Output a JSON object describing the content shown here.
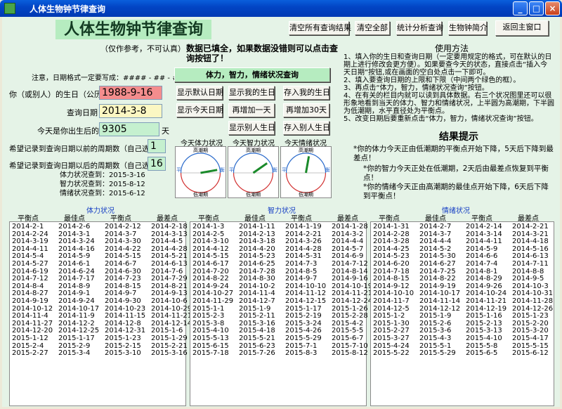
{
  "window": {
    "title": "人体生物钟节律查询"
  },
  "header": {
    "main_title": "人体生物钟节律查询",
    "subtitle": "（仅作参考，不可认真）",
    "notice": "数据已填全，如果数据没错则可以点击查询按钮了！"
  },
  "toolbar": {
    "clear_results": "清空所有查询结果",
    "clear_all": "清空全部",
    "stats": "统计分析查询",
    "intro": "生物钟简介",
    "back": "返回主窗口"
  },
  "form": {
    "date_format_note": "注意，日期格式一定要写成：#### - ## - ##",
    "query_button": "体力，智力，情绪状况查询",
    "birthday_label": "你（或别人）的生日（公历）",
    "birthday_value": "1988-9-16",
    "query_date_label": "查询日期",
    "query_date_value": "2014-3-8",
    "days_label": "今天是你出生后的第",
    "days_value": "9305",
    "days_unit": "天",
    "before_label": "希望记录到查询日期以前的周期数（自己选）",
    "before_value": "1",
    "after_label": "希望记录到查询日期以后的周期数（自己选）",
    "after_value": "16",
    "phys_end": "体力状况查到：2015-3-16",
    "intel_end": "智力状况查到：2015-8-12",
    "emot_end": "情绪状况查到：2015-6-12"
  },
  "buttons": {
    "show_default_birthday": "显示默认日期",
    "show_my_birthday": "显示我的生日",
    "save_my_birthday": "存入我的生日",
    "show_today": "显示今天日期",
    "add_one_day": "再增加一天",
    "add_30_days": "再增加30天",
    "show_other_birthday": "显示别人生日",
    "save_other_birthday": "存入别人生日"
  },
  "charts": [
    {
      "title": "今天体力状况",
      "top_label": "高潮期",
      "bottom_label": "低潮期",
      "left_label": "平",
      "right_label": "衡",
      "needle_angle_deg": -10
    },
    {
      "title": "今天智力状况",
      "top_label": "高潮期",
      "bottom_label": "低潮期",
      "left_label": "平",
      "right_label": "衡",
      "needle_angle_deg": -35
    },
    {
      "title": "今天情绪状况",
      "top_label": "高潮期",
      "bottom_label": "低潮期",
      "left_label": "平",
      "right_label": "衡",
      "needle_angle_deg": -80
    }
  ],
  "usage": {
    "title": "使用方法",
    "steps": [
      "1、填入你的生日和查询日期（一定要用规定的格式，可在默认的日期上进行修改会更方便）。如果要查今天的状态，直接点击“插入今天日期”按钮,或在画面的空白处点击一下即可。",
      "2、填入要查询日期的上限和下限（中间两个绿色的框）。",
      "3、再点击“体力，智力，情绪状况查询”按钮。",
      "4、在有关的栏目内就可以读到具体数据。右三个状况图里还可以很形象地看到当天的体力、智力和情绪状况，上半圆为高潮期，下半圆为低潮期，水平直径处为平衡点。",
      "5、改变日期后要重新点击“体力，智力，情绪状况查询”按钮。"
    ]
  },
  "result": {
    "title": "结果提示",
    "lines": [
      "*你的体力今天正由低潮期的平衡点开始下降，5天后下降到最差点！",
      "*你的智力今天正处在低潮期，2天后由最差点恢复到平衡点！",
      "*你的情绪今天正由高潮期的最佳点开始下降，6天后下降到平衡点！"
    ]
  },
  "lists": [
    {
      "title": "体力状况",
      "headers": [
        "平衡点",
        "最佳点",
        "平衡点",
        "最差点"
      ],
      "rows": [
        [
          "2014-2-1",
          "2014-2-6",
          "2014-2-12",
          "2014-2-18"
        ],
        [
          "2014-2-24",
          "2014-3-1",
          "2014-3-7",
          "2014-3-13"
        ],
        [
          "2014-3-19",
          "2014-3-24",
          "2014-3-30",
          "2014-4-5"
        ],
        [
          "2014-4-11",
          "2014-4-16",
          "2014-4-22",
          "2014-4-28"
        ],
        [
          "2014-5-4",
          "2014-5-9",
          "2014-5-15",
          "2014-5-21"
        ],
        [
          "2014-5-27",
          "2014-6-1",
          "2014-6-7",
          "2014-6-13"
        ],
        [
          "2014-6-19",
          "2014-6-24",
          "2014-6-30",
          "2014-7-6"
        ],
        [
          "2014-7-12",
          "2014-7-17",
          "2014-7-23",
          "2014-7-29"
        ],
        [
          "2014-8-4",
          "2014-8-9",
          "2014-8-15",
          "2014-8-21"
        ],
        [
          "2014-8-27",
          "2014-9-1",
          "2014-9-7",
          "2014-9-13"
        ],
        [
          "2014-9-19",
          "2014-9-24",
          "2014-9-30",
          "2014-10-6"
        ],
        [
          "2014-10-12",
          "2014-10-17",
          "2014-10-23",
          "2014-10-29"
        ],
        [
          "2014-11-4",
          "2014-11-9",
          "2014-11-15",
          "2014-11-21"
        ],
        [
          "2014-11-27",
          "2014-12-2",
          "2014-12-8",
          "2014-12-14"
        ],
        [
          "2014-12-20",
          "2014-12-25",
          "2014-12-31",
          "2015-1-6"
        ],
        [
          "2015-1-12",
          "2015-1-17",
          "2015-1-23",
          "2015-1-29"
        ],
        [
          "2015-2-4",
          "2015-2-9",
          "2015-2-15",
          "2015-2-21"
        ],
        [
          "2015-2-27",
          "2015-3-4",
          "2015-3-10",
          "2015-3-16"
        ]
      ]
    },
    {
      "title": "智力状况",
      "headers": [
        "平衡点",
        "最佳点",
        "平衡点",
        "最差点"
      ],
      "rows": [
        [
          "2014-1-3",
          "2014-1-11",
          "2014-1-19",
          "2014-1-28"
        ],
        [
          "2014-2-5",
          "2014-2-13",
          "2014-2-21",
          "2014-3-2"
        ],
        [
          "2014-3-10",
          "2014-3-18",
          "2014-3-26",
          "2014-4-4"
        ],
        [
          "2014-4-12",
          "2014-4-20",
          "2014-4-28",
          "2014-5-7"
        ],
        [
          "2014-5-15",
          "2014-5-23",
          "2014-5-31",
          "2014-6-9"
        ],
        [
          "2014-6-17",
          "2014-6-25",
          "2014-7-3",
          "2014-7-12"
        ],
        [
          "2014-7-20",
          "2014-7-28",
          "2014-8-5",
          "2014-8-14"
        ],
        [
          "2014-8-22",
          "2014-8-30",
          "2014-9-7",
          "2014-9-16"
        ],
        [
          "2014-9-24",
          "2014-10-2",
          "2014-10-10",
          "2014-10-19"
        ],
        [
          "2014-10-27",
          "2014-11-4",
          "2014-11-12",
          "2014-11-21"
        ],
        [
          "2014-11-29",
          "2014-12-7",
          "2014-12-15",
          "2014-12-24"
        ],
        [
          "2015-1-1",
          "2015-1-9",
          "2015-1-17",
          "2015-1-26"
        ],
        [
          "2015-2-3",
          "2015-2-11",
          "2015-2-19",
          "2015-2-28"
        ],
        [
          "2015-3-8",
          "2015-3-16",
          "2015-3-24",
          "2015-4-2"
        ],
        [
          "2015-4-10",
          "2015-4-18",
          "2015-4-26",
          "2015-5-5"
        ],
        [
          "2015-5-13",
          "2015-5-21",
          "2015-5-29",
          "2015-6-7"
        ],
        [
          "2015-6-15",
          "2015-6-23",
          "2015-7-1",
          "2015-7-10"
        ],
        [
          "2015-7-18",
          "2015-7-26",
          "2015-8-3",
          "2015-8-12"
        ]
      ]
    },
    {
      "title": "情绪状况",
      "headers": [
        "平衡点",
        "最佳点",
        "平衡点",
        "最差点"
      ],
      "rows": [
        [
          "2014-1-31",
          "2014-2-7",
          "2014-2-14",
          "2014-2-21"
        ],
        [
          "2014-2-28",
          "2014-3-7",
          "2014-3-14",
          "2014-3-21"
        ],
        [
          "2014-3-28",
          "2014-4-4",
          "2014-4-11",
          "2014-4-18"
        ],
        [
          "2014-4-25",
          "2014-5-2",
          "2014-5-9",
          "2014-5-16"
        ],
        [
          "2014-5-23",
          "2014-5-30",
          "2014-6-6",
          "2014-6-13"
        ],
        [
          "2014-6-20",
          "2014-6-27",
          "2014-7-4",
          "2014-7-11"
        ],
        [
          "2014-7-18",
          "2014-7-25",
          "2014-8-1",
          "2014-8-8"
        ],
        [
          "2014-8-15",
          "2014-8-22",
          "2014-8-29",
          "2014-9-5"
        ],
        [
          "2014-9-12",
          "2014-9-19",
          "2014-9-26",
          "2014-10-3"
        ],
        [
          "2014-10-10",
          "2014-10-17",
          "2014-10-24",
          "2014-10-31"
        ],
        [
          "2014-11-7",
          "2014-11-14",
          "2014-11-21",
          "2014-11-28"
        ],
        [
          "2014-12-5",
          "2014-12-12",
          "2014-12-19",
          "2014-12-26"
        ],
        [
          "2015-1-2",
          "2015-1-9",
          "2015-1-16",
          "2015-1-23"
        ],
        [
          "2015-1-30",
          "2015-2-6",
          "2015-2-13",
          "2015-2-20"
        ],
        [
          "2015-2-27",
          "2015-3-6",
          "2015-3-13",
          "2015-3-20"
        ],
        [
          "2015-3-27",
          "2015-4-3",
          "2015-4-10",
          "2015-4-17"
        ],
        [
          "2015-4-24",
          "2015-5-1",
          "2015-5-8",
          "2015-5-15"
        ],
        [
          "2015-5-22",
          "2015-5-29",
          "2015-6-5",
          "2015-6-12"
        ]
      ]
    }
  ]
}
